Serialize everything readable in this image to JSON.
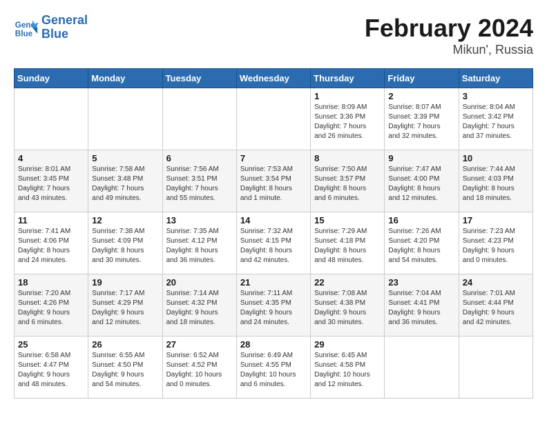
{
  "header": {
    "logo_line1": "General",
    "logo_line2": "Blue",
    "month_year": "February 2024",
    "location": "Mikun', Russia"
  },
  "weekdays": [
    "Sunday",
    "Monday",
    "Tuesday",
    "Wednesday",
    "Thursday",
    "Friday",
    "Saturday"
  ],
  "weeks": [
    [
      {
        "day": "",
        "info": ""
      },
      {
        "day": "",
        "info": ""
      },
      {
        "day": "",
        "info": ""
      },
      {
        "day": "",
        "info": ""
      },
      {
        "day": "1",
        "info": "Sunrise: 8:09 AM\nSunset: 3:36 PM\nDaylight: 7 hours\nand 26 minutes."
      },
      {
        "day": "2",
        "info": "Sunrise: 8:07 AM\nSunset: 3:39 PM\nDaylight: 7 hours\nand 32 minutes."
      },
      {
        "day": "3",
        "info": "Sunrise: 8:04 AM\nSunset: 3:42 PM\nDaylight: 7 hours\nand 37 minutes."
      }
    ],
    [
      {
        "day": "4",
        "info": "Sunrise: 8:01 AM\nSunset: 3:45 PM\nDaylight: 7 hours\nand 43 minutes."
      },
      {
        "day": "5",
        "info": "Sunrise: 7:58 AM\nSunset: 3:48 PM\nDaylight: 7 hours\nand 49 minutes."
      },
      {
        "day": "6",
        "info": "Sunrise: 7:56 AM\nSunset: 3:51 PM\nDaylight: 7 hours\nand 55 minutes."
      },
      {
        "day": "7",
        "info": "Sunrise: 7:53 AM\nSunset: 3:54 PM\nDaylight: 8 hours\nand 1 minute."
      },
      {
        "day": "8",
        "info": "Sunrise: 7:50 AM\nSunset: 3:57 PM\nDaylight: 8 hours\nand 6 minutes."
      },
      {
        "day": "9",
        "info": "Sunrise: 7:47 AM\nSunset: 4:00 PM\nDaylight: 8 hours\nand 12 minutes."
      },
      {
        "day": "10",
        "info": "Sunrise: 7:44 AM\nSunset: 4:03 PM\nDaylight: 8 hours\nand 18 minutes."
      }
    ],
    [
      {
        "day": "11",
        "info": "Sunrise: 7:41 AM\nSunset: 4:06 PM\nDaylight: 8 hours\nand 24 minutes."
      },
      {
        "day": "12",
        "info": "Sunrise: 7:38 AM\nSunset: 4:09 PM\nDaylight: 8 hours\nand 30 minutes."
      },
      {
        "day": "13",
        "info": "Sunrise: 7:35 AM\nSunset: 4:12 PM\nDaylight: 8 hours\nand 36 minutes."
      },
      {
        "day": "14",
        "info": "Sunrise: 7:32 AM\nSunset: 4:15 PM\nDaylight: 8 hours\nand 42 minutes."
      },
      {
        "day": "15",
        "info": "Sunrise: 7:29 AM\nSunset: 4:18 PM\nDaylight: 8 hours\nand 48 minutes."
      },
      {
        "day": "16",
        "info": "Sunrise: 7:26 AM\nSunset: 4:20 PM\nDaylight: 8 hours\nand 54 minutes."
      },
      {
        "day": "17",
        "info": "Sunrise: 7:23 AM\nSunset: 4:23 PM\nDaylight: 9 hours\nand 0 minutes."
      }
    ],
    [
      {
        "day": "18",
        "info": "Sunrise: 7:20 AM\nSunset: 4:26 PM\nDaylight: 9 hours\nand 6 minutes."
      },
      {
        "day": "19",
        "info": "Sunrise: 7:17 AM\nSunset: 4:29 PM\nDaylight: 9 hours\nand 12 minutes."
      },
      {
        "day": "20",
        "info": "Sunrise: 7:14 AM\nSunset: 4:32 PM\nDaylight: 9 hours\nand 18 minutes."
      },
      {
        "day": "21",
        "info": "Sunrise: 7:11 AM\nSunset: 4:35 PM\nDaylight: 9 hours\nand 24 minutes."
      },
      {
        "day": "22",
        "info": "Sunrise: 7:08 AM\nSunset: 4:38 PM\nDaylight: 9 hours\nand 30 minutes."
      },
      {
        "day": "23",
        "info": "Sunrise: 7:04 AM\nSunset: 4:41 PM\nDaylight: 9 hours\nand 36 minutes."
      },
      {
        "day": "24",
        "info": "Sunrise: 7:01 AM\nSunset: 4:44 PM\nDaylight: 9 hours\nand 42 minutes."
      }
    ],
    [
      {
        "day": "25",
        "info": "Sunrise: 6:58 AM\nSunset: 4:47 PM\nDaylight: 9 hours\nand 48 minutes."
      },
      {
        "day": "26",
        "info": "Sunrise: 6:55 AM\nSunset: 4:50 PM\nDaylight: 9 hours\nand 54 minutes."
      },
      {
        "day": "27",
        "info": "Sunrise: 6:52 AM\nSunset: 4:52 PM\nDaylight: 10 hours\nand 0 minutes."
      },
      {
        "day": "28",
        "info": "Sunrise: 6:49 AM\nSunset: 4:55 PM\nDaylight: 10 hours\nand 6 minutes."
      },
      {
        "day": "29",
        "info": "Sunrise: 6:45 AM\nSunset: 4:58 PM\nDaylight: 10 hours\nand 12 minutes."
      },
      {
        "day": "",
        "info": ""
      },
      {
        "day": "",
        "info": ""
      }
    ]
  ]
}
